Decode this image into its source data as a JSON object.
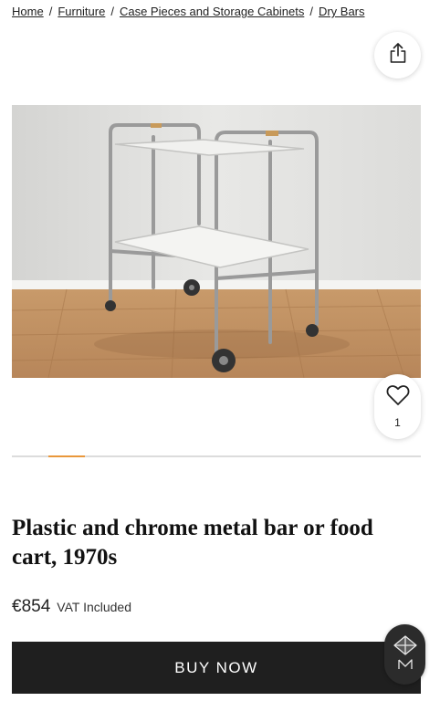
{
  "breadcrumb": {
    "items": [
      "Home",
      "Furniture",
      "Case Pieces and Storage Cabinets",
      "Dry Bars"
    ],
    "separator": "/"
  },
  "product": {
    "title": "Plastic and chrome metal bar or food cart, 1970s",
    "price": "€854",
    "vat": "VAT Included",
    "favorites_count": "1",
    "image_alt": "Plastic and chrome metal bar cart on wooden floor"
  },
  "actions": {
    "buy_now": "BUY NOW"
  },
  "carousel": {
    "active_index": 1
  },
  "icons": {
    "share": "share-icon",
    "favorite": "heart-icon",
    "chat": "diamond-logo-icon"
  },
  "colors": {
    "accent": "#e9973b",
    "buy_button": "#1f1f1f",
    "badge": "#2b2b2b"
  }
}
